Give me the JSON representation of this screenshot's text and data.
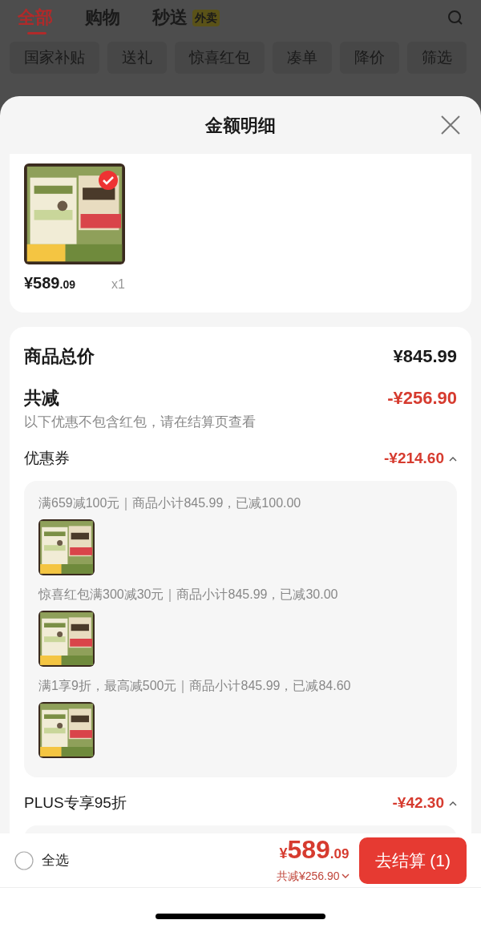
{
  "background_page": {
    "tabs": [
      {
        "label": "全部",
        "selected": true
      },
      {
        "label": "购物",
        "selected": false
      },
      {
        "label": "秒送",
        "selected": false,
        "badge": "外卖"
      }
    ],
    "filters": [
      "国家补贴",
      "送礼",
      "惊喜红包",
      "凑单",
      "降价",
      "筛选"
    ]
  },
  "sheet": {
    "title": "金额明细",
    "product": {
      "price_main": "¥589",
      "price_decimal": ".09",
      "quantity": "x1",
      "checked": true
    },
    "summary": {
      "total_label": "商品总价",
      "total_value": "¥845.99",
      "discount_label": "共减",
      "discount_value": "-¥256.90",
      "note": "以下优惠不包含红包，请在结算页查看",
      "groups": [
        {
          "label": "优惠券",
          "amount": "-¥214.60",
          "expanded": true,
          "items": [
            {
              "text": "满659减100元｜商品小计845.99，已减100.00"
            },
            {
              "text": "惊喜红包满300减30元｜商品小计845.99，已减30.00"
            },
            {
              "text": "满1享9折，最高减500元｜商品小计845.99，已减84.60"
            }
          ]
        },
        {
          "label": "PLUS专享95折",
          "amount": "-¥42.30",
          "expanded": true
        }
      ]
    }
  },
  "bottom_bar": {
    "select_all": {
      "label": "全选",
      "checked": false
    },
    "currency": "¥",
    "price_main": "589",
    "price_decimal": ".09",
    "reduced": "共减¥256.90",
    "checkout": "去结算 (1)"
  }
}
